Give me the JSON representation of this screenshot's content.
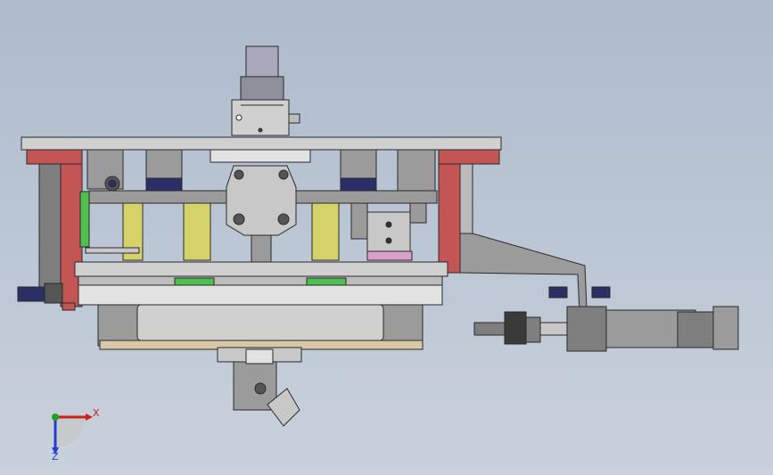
{
  "triad": {
    "x_label": "X",
    "z_label": "Z",
    "x_color": "#cc1f1f",
    "z_color": "#1f3fcc",
    "y_color": "#1fa01f"
  },
  "colors": {
    "background": "#b8c3d1",
    "part_gray": "#c8c8c8",
    "part_dark": "#7e7e7e",
    "outline": "#2a2a2a",
    "red_frame": "#c45555",
    "yellow_block": "#d6d26a",
    "green_guide": "#4fc04f",
    "navy_fitting": "#2a3066",
    "pink_block": "#d9a0c8",
    "tan_plate": "#d8c8a8"
  }
}
